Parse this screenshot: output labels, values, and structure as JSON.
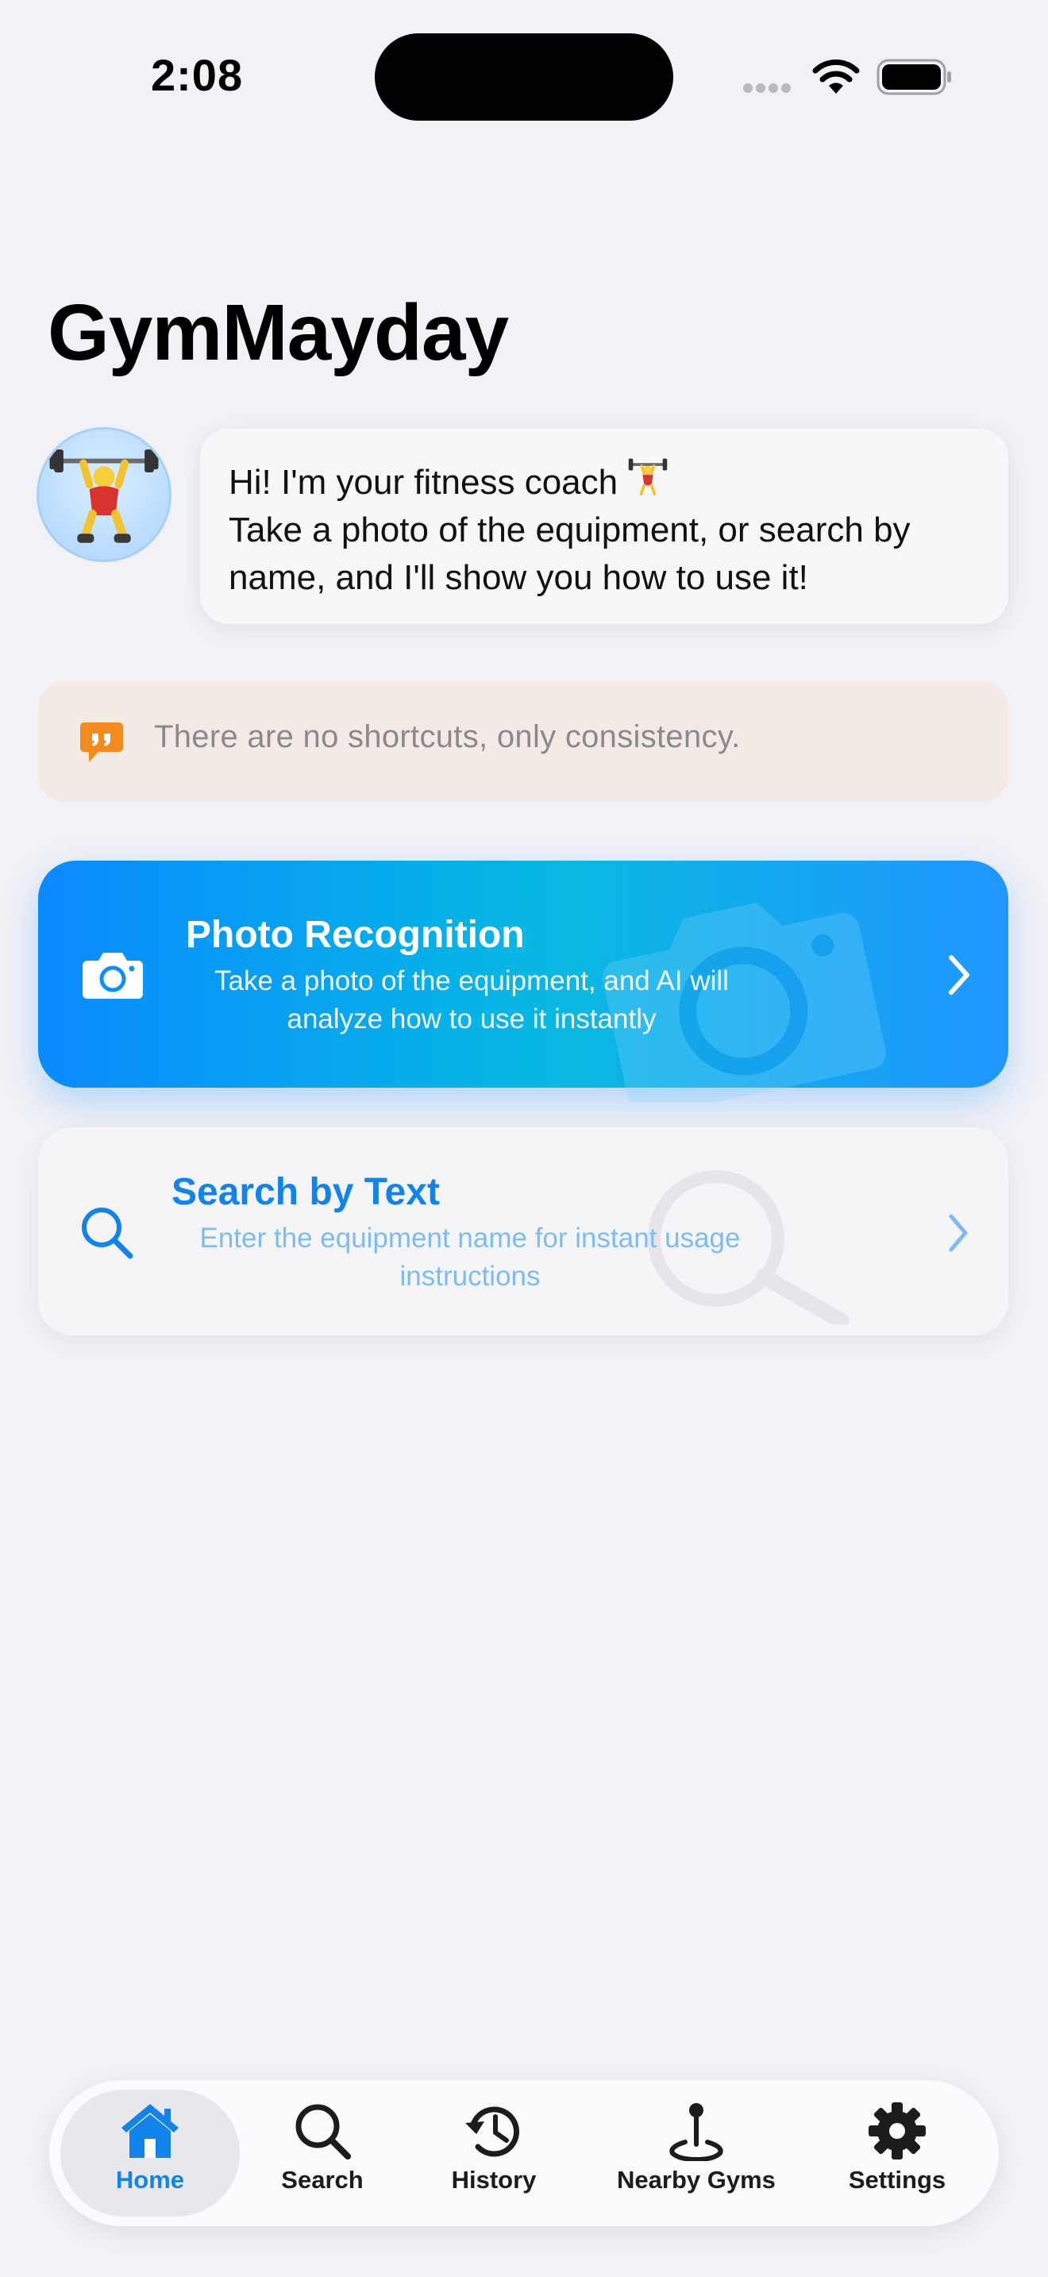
{
  "status_bar": {
    "time": "2:08"
  },
  "app": {
    "title": "GymMayday"
  },
  "coach": {
    "greeting": "Hi! I'm your fitness coach",
    "line2": "Take a photo of the equipment, or search by",
    "line3": "name, and I'll show you how to use it!",
    "avatar_icon": "weightlifter-emoji"
  },
  "quote": {
    "text": "There are no shortcuts, only consistency.",
    "icon": "quote-bubble-icon"
  },
  "photo_card": {
    "title": "Photo Recognition",
    "subtitle": "Take a photo of the equipment, and AI will analyze how to use it instantly",
    "icon": "camera-icon"
  },
  "search_card": {
    "title": "Search by Text",
    "subtitle": "Enter the equipment name for instant usage instructions",
    "icon": "search-icon"
  },
  "tabs": [
    {
      "label": "Home",
      "icon": "home-icon",
      "active": true
    },
    {
      "label": "Search",
      "icon": "search-icon",
      "active": false
    },
    {
      "label": "History",
      "icon": "history-icon",
      "active": false
    },
    {
      "label": "Nearby Gyms",
      "icon": "pin-icon",
      "active": false
    },
    {
      "label": "Settings",
      "icon": "gear-icon",
      "active": false
    }
  ],
  "colors": {
    "accent": "#1183ea",
    "background": "#f1f1f6",
    "quote_bg": "#f3eae6"
  }
}
